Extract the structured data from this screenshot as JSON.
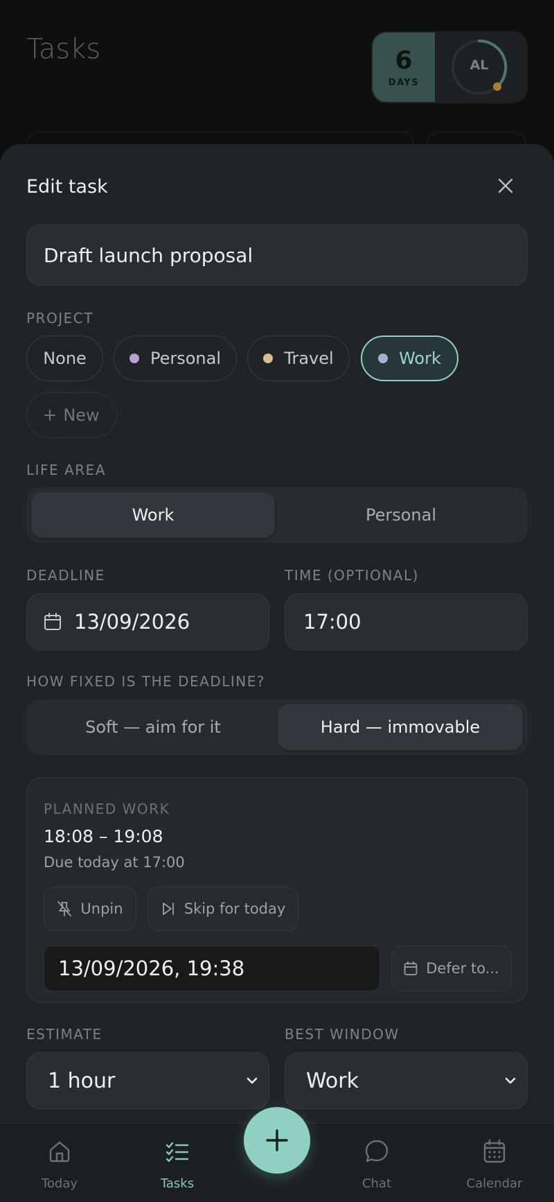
{
  "background": {
    "page_title": "Tasks",
    "streak": {
      "count": "6",
      "label": "DAYS"
    },
    "avatar_initials": "AL"
  },
  "sheet": {
    "title": "Edit task",
    "task_title": "Draft launch proposal",
    "project": {
      "label": "PROJECT",
      "options": [
        {
          "label": "None",
          "dot": null,
          "selected": false
        },
        {
          "label": "Personal",
          "dot": "#b7a2d6",
          "selected": false
        },
        {
          "label": "Travel",
          "dot": "#d9c08a",
          "selected": false
        },
        {
          "label": "Work",
          "dot": "#9fb3d4",
          "selected": true
        }
      ],
      "new_label": "New"
    },
    "life_area": {
      "label": "LIFE AREA",
      "options": [
        "Work",
        "Personal"
      ],
      "selected": "Work"
    },
    "deadline": {
      "label": "DEADLINE",
      "value": "13/09/2026"
    },
    "time": {
      "label": "TIME (OPTIONAL)",
      "value": "17:00"
    },
    "fixedness": {
      "label": "HOW FIXED IS THE DEADLINE?",
      "options": [
        "Soft — aim for it",
        "Hard — immovable"
      ],
      "selected": "Hard — immovable"
    },
    "planned": {
      "label": "PLANNED WORK",
      "time_range": "18:08 – 19:08",
      "due_text": "Due today at 17:00",
      "unpin_label": "Unpin",
      "skip_label": "Skip for today",
      "defer_value": "13/09/2026, 19:38",
      "defer_label": "Defer to..."
    },
    "estimate": {
      "label": "ESTIMATE",
      "value": "1 hour"
    },
    "best_window": {
      "label": "BEST WINDOW",
      "value": "Work"
    }
  },
  "nav": {
    "items": [
      {
        "label": "Today",
        "icon": "home-icon",
        "active": false
      },
      {
        "label": "Tasks",
        "icon": "tasks-icon",
        "active": true
      },
      {
        "label": "Chat",
        "icon": "chat-icon",
        "active": false
      },
      {
        "label": "Calendar",
        "icon": "calendar-icon",
        "active": false
      }
    ],
    "fab_icon": "plus-icon"
  },
  "colors": {
    "accent": "#8ed0c1",
    "sheet_bg": "#212427",
    "field_bg": "#2a2e32"
  }
}
